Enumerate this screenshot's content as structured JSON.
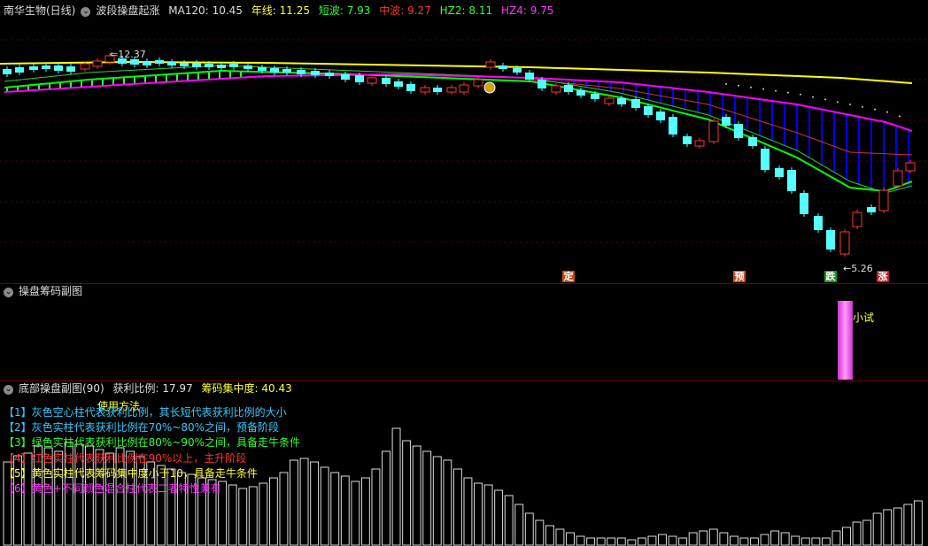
{
  "main": {
    "stock_name": "南华生物(日线)",
    "indicator_name": "波段操盘起涨",
    "ma120_label": "MA120:",
    "ma120_value": "10.45",
    "year_label": "年线:",
    "year_value": "11.25",
    "short_label": "短波:",
    "short_value": "7.93",
    "mid_label": "中波:",
    "mid_value": "9.27",
    "hz2_label": "HZ2:",
    "hz2_value": "8.11",
    "hz4_label": "HZ4:",
    "hz4_value": "9.75",
    "high_marker": "12.37",
    "low_marker": "5.26",
    "signals": [
      {
        "text": "定",
        "color": "#c84a1a"
      },
      {
        "text": "预",
        "color": "#c84a1a"
      },
      {
        "text": "跌",
        "color": "#1a9a1a"
      },
      {
        "text": "涨",
        "color": "#c81a1a"
      }
    ],
    "colors": {
      "yellow_line": "#ffff00",
      "magenta_line": "#ff00ff",
      "green_line": "#00ff00",
      "up_candle": "#ff3333",
      "down_candle": "#54ffff",
      "band_fill": "#0000ff"
    }
  },
  "chip": {
    "title": "操盘筹码副图",
    "label": "小试",
    "bar_color": "#ff66ff"
  },
  "bottom": {
    "title": "底部操盘副图(90)",
    "profit_label": "获利比例:",
    "profit_value": "17.97",
    "concentration_label": "筹码集中度:",
    "concentration_value": "40.43",
    "usage_title": "使用方法",
    "notes": [
      {
        "text": "【1】灰色空心柱代表获利比例，其长短代表获利比例的大小",
        "color": "#33ccff"
      },
      {
        "text": "【2】灰色实柱代表获利比例在70%~80%之间，预备阶段",
        "color": "#33ccff"
      },
      {
        "text": "【3】绿色实柱代表获利比例在80%~90%之间，具备走牛条件",
        "color": "#33ff33"
      },
      {
        "text": "【4】红色实柱代表获利比例在90%以上，主升阶段",
        "color": "#ff3333"
      },
      {
        "text": "【5】黄色实柱代表筹码集中度小于10，具备走牛条件",
        "color": "#ffff33"
      },
      {
        "text": "【6】黄色+不同颜色混合柱代表二者特性兼有",
        "color": "#ff33ff"
      }
    ]
  }
}
